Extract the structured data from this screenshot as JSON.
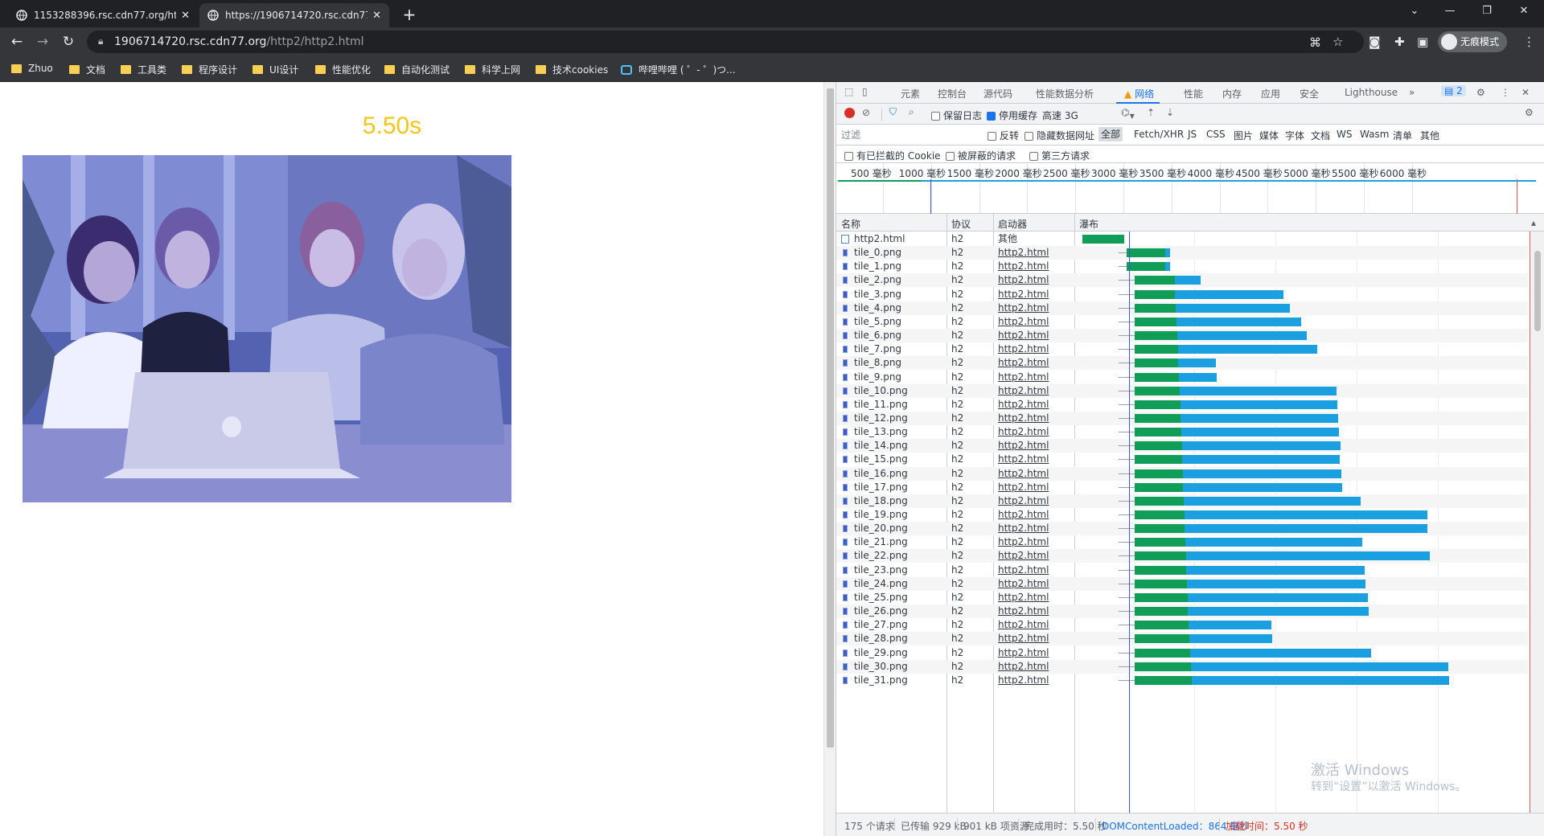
{
  "browser": {
    "tabs": [
      {
        "title": "1153288396.rsc.cdn77.org/http",
        "active": false
      },
      {
        "title": "https://1906714720.rsc.cdn77.",
        "active": true
      }
    ],
    "url_host": "1906714720.rsc.cdn77.org",
    "url_path": "/http2/http2.html",
    "incognito_label": "无痕模式",
    "bookmarks": [
      "Zhuo",
      "文档",
      "工具类",
      "程序设计",
      "UI设计",
      "性能优化",
      "自动化测试",
      "科学上网",
      "技术cookies",
      "哔哩哔哩 ( ゜- ゜)つ..."
    ]
  },
  "page": {
    "timer": "5.50s"
  },
  "devtools": {
    "tabs": [
      "元素",
      "控制台",
      "源代码",
      "性能数据分析",
      "网络",
      "性能",
      "内存",
      "应用",
      "安全",
      "Lighthouse"
    ],
    "active_tab": "网络",
    "issues_count": "2",
    "toolbar": {
      "preserve_log": "保留日志",
      "disable_cache": "停用缓存",
      "throttle": "高速 3G"
    },
    "filter": {
      "placeholder": "过滤",
      "invert": "反转",
      "hide_data_urls": "隐藏数据网址",
      "types": [
        "全部",
        "Fetch/XHR",
        "JS",
        "CSS",
        "图片",
        "媒体",
        "字体",
        "文档",
        "WS",
        "Wasm",
        "清单",
        "其他"
      ],
      "selected_type": "全部",
      "blocked_cookies": "有已拦截的 Cookie",
      "blocked_requests": "被屏蔽的请求",
      "third_party": "第三方请求"
    },
    "overview_ticks": [
      "500 毫秒",
      "1000 毫秒",
      "1500 毫秒",
      "2000 毫秒",
      "2500 毫秒",
      "3000 毫秒",
      "3500 毫秒",
      "4000 毫秒",
      "4500 毫秒",
      "5000 毫秒",
      "5500 毫秒",
      "6000 毫秒"
    ],
    "columns": {
      "name": "名称",
      "protocol": "协议",
      "initiator": "启动器",
      "waterfall": "瀑布"
    },
    "requests": [
      {
        "name": "http2.html",
        "protocol": "h2",
        "initiator": "其他",
        "type": "doc",
        "wait": 0,
        "green": 52,
        "blue": 0
      },
      {
        "name": "tile_0.png",
        "protocol": "h2",
        "initiator": "http2.html",
        "wait": 55,
        "green": 48,
        "blue": 6
      },
      {
        "name": "tile_1.png",
        "protocol": "h2",
        "initiator": "http2.html",
        "wait": 55,
        "green": 48,
        "blue": 6
      },
      {
        "name": "tile_2.png",
        "protocol": "h2",
        "initiator": "http2.html",
        "wait": 65,
        "green": 50,
        "blue": 32
      },
      {
        "name": "tile_3.png",
        "protocol": "h2",
        "initiator": "http2.html",
        "wait": 65,
        "green": 50,
        "blue": 135
      },
      {
        "name": "tile_4.png",
        "protocol": "h2",
        "initiator": "http2.html",
        "wait": 65,
        "green": 51,
        "blue": 142
      },
      {
        "name": "tile_5.png",
        "protocol": "h2",
        "initiator": "http2.html",
        "wait": 65,
        "green": 52,
        "blue": 155
      },
      {
        "name": "tile_6.png",
        "protocol": "h2",
        "initiator": "http2.html",
        "wait": 65,
        "green": 53,
        "blue": 161
      },
      {
        "name": "tile_7.png",
        "protocol": "h2",
        "initiator": "http2.html",
        "wait": 65,
        "green": 54,
        "blue": 173
      },
      {
        "name": "tile_8.png",
        "protocol": "h2",
        "initiator": "http2.html",
        "wait": 65,
        "green": 54,
        "blue": 47
      },
      {
        "name": "tile_9.png",
        "protocol": "h2",
        "initiator": "http2.html",
        "wait": 65,
        "green": 55,
        "blue": 47
      },
      {
        "name": "tile_10.png",
        "protocol": "h2",
        "initiator": "http2.html",
        "wait": 65,
        "green": 56,
        "blue": 195
      },
      {
        "name": "tile_11.png",
        "protocol": "h2",
        "initiator": "http2.html",
        "wait": 65,
        "green": 57,
        "blue": 195
      },
      {
        "name": "tile_12.png",
        "protocol": "h2",
        "initiator": "http2.html",
        "wait": 65,
        "green": 57,
        "blue": 196
      },
      {
        "name": "tile_13.png",
        "protocol": "h2",
        "initiator": "http2.html",
        "wait": 65,
        "green": 58,
        "blue": 196
      },
      {
        "name": "tile_14.png",
        "protocol": "h2",
        "initiator": "http2.html",
        "wait": 65,
        "green": 59,
        "blue": 197
      },
      {
        "name": "tile_15.png",
        "protocol": "h2",
        "initiator": "http2.html",
        "wait": 65,
        "green": 59,
        "blue": 196
      },
      {
        "name": "tile_16.png",
        "protocol": "h2",
        "initiator": "http2.html",
        "wait": 65,
        "green": 60,
        "blue": 197
      },
      {
        "name": "tile_17.png",
        "protocol": "h2",
        "initiator": "http2.html",
        "wait": 65,
        "green": 60,
        "blue": 198
      },
      {
        "name": "tile_18.png",
        "protocol": "h2",
        "initiator": "http2.html",
        "wait": 65,
        "green": 61,
        "blue": 220
      },
      {
        "name": "tile_19.png",
        "protocol": "h2",
        "initiator": "http2.html",
        "wait": 65,
        "green": 62,
        "blue": 302
      },
      {
        "name": "tile_20.png",
        "protocol": "h2",
        "initiator": "http2.html",
        "wait": 65,
        "green": 62,
        "blue": 302
      },
      {
        "name": "tile_21.png",
        "protocol": "h2",
        "initiator": "http2.html",
        "wait": 65,
        "green": 63,
        "blue": 220
      },
      {
        "name": "tile_22.png",
        "protocol": "h2",
        "initiator": "http2.html",
        "wait": 65,
        "green": 64,
        "blue": 303
      },
      {
        "name": "tile_23.png",
        "protocol": "h2",
        "initiator": "http2.html",
        "wait": 65,
        "green": 64,
        "blue": 222
      },
      {
        "name": "tile_24.png",
        "protocol": "h2",
        "initiator": "http2.html",
        "wait": 65,
        "green": 65,
        "blue": 222
      },
      {
        "name": "tile_25.png",
        "protocol": "h2",
        "initiator": "http2.html",
        "wait": 65,
        "green": 66,
        "blue": 224
      },
      {
        "name": "tile_26.png",
        "protocol": "h2",
        "initiator": "http2.html",
        "wait": 65,
        "green": 66,
        "blue": 225
      },
      {
        "name": "tile_27.png",
        "protocol": "h2",
        "initiator": "http2.html",
        "wait": 65,
        "green": 67,
        "blue": 103
      },
      {
        "name": "tile_28.png",
        "protocol": "h2",
        "initiator": "http2.html",
        "wait": 65,
        "green": 68,
        "blue": 103
      },
      {
        "name": "tile_29.png",
        "protocol": "h2",
        "initiator": "http2.html",
        "wait": 65,
        "green": 69,
        "blue": 225
      },
      {
        "name": "tile_30.png",
        "protocol": "h2",
        "initiator": "http2.html",
        "wait": 65,
        "green": 70,
        "blue": 320
      },
      {
        "name": "tile_31.png",
        "protocol": "h2",
        "initiator": "http2.html",
        "wait": 65,
        "green": 71,
        "blue": 320
      }
    ],
    "status": {
      "requests": "175 个请求",
      "transferred": "已传输 929 kB",
      "resources": "901 kB 项资源",
      "finish": "完成用时：5.50 秒",
      "dcl_label": "DOMContentLoaded：",
      "dcl_value": "864 毫秒",
      "load_label": "加载时间：",
      "load_value": "5.50 秒"
    }
  },
  "os_watermark": {
    "line1": "激活 Windows",
    "line2": "转到“设置”以激活 Windows。"
  },
  "colors": {
    "timer": "#f5c518",
    "wf_green": "#0f9d58",
    "wf_blue": "#1a9fe0",
    "dcl_line": "#3b58d6",
    "load_line": "#e8515e",
    "accent": "#1a73e8"
  }
}
